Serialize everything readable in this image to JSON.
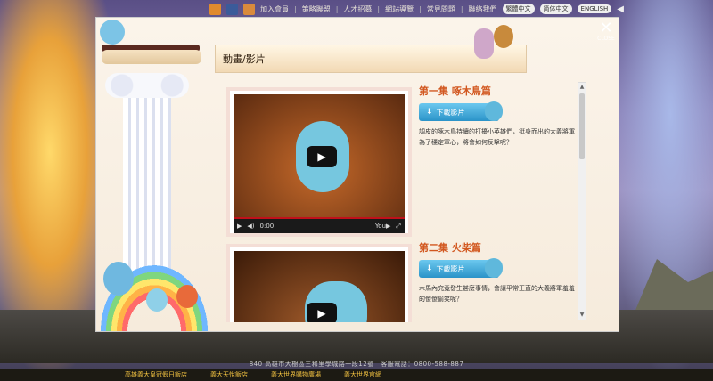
{
  "topbar": {
    "social": [
      "blogger-icon",
      "facebook-icon",
      "plurk-icon"
    ],
    "nav": [
      "加入會員",
      "策略聯盟",
      "人才招募",
      "網站導覽",
      "常見問題",
      "聯絡我們"
    ],
    "languages": [
      "繁體中文",
      "简体中文",
      "ENGLISH"
    ]
  },
  "modal": {
    "heading": "動畫/影片",
    "close_label": "CLOSE"
  },
  "episodes": [
    {
      "title": "第一集 啄木鳥篇",
      "button_label": "下載影片",
      "description": "調皮的啄木鳥持續的打擾小英雄們，挺身而出的大義將軍為了穩定軍心，將會如何反擊呢？",
      "video_time": "0:00"
    },
    {
      "title": "第二集 火柴篇",
      "button_label": "下載影片",
      "description": "木馬內究竟發生甚麼事情，會讓平常正直的大義將軍羞羞的傻傻偷笑呢？"
    }
  ],
  "footer": {
    "address": "840 高雄市大樹區三和里學城路一段12號　客服電話：0800-588-887",
    "links": [
      "高雄義大皇冠假日飯店",
      "義大天悅飯店",
      "義大世界購物廣場",
      "義大世界官網"
    ]
  },
  "colors": {
    "title": "#d2571f",
    "button": "#2a93c8",
    "footer_link": "#f0c040"
  }
}
